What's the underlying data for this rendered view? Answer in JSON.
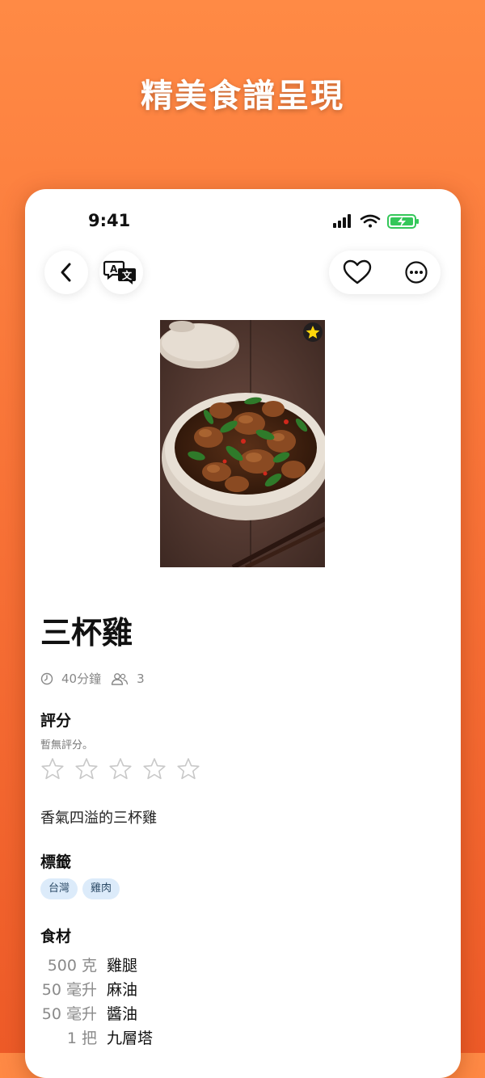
{
  "hero": {
    "title": "精美食譜呈現"
  },
  "status_bar": {
    "time": "9:41"
  },
  "toolbar": {
    "back": "back",
    "translate": "translate",
    "favorite": "favorite",
    "more": "more"
  },
  "recipe": {
    "title": "三杯雞",
    "time": "40分鐘",
    "servings": "3",
    "rating_label": "評分",
    "rating_note": "暫無評分。",
    "rating_value": 0,
    "rating_max": 5,
    "description": "香氣四溢的三杯雞",
    "tags_label": "標籤",
    "tags": [
      "台灣",
      "雞肉"
    ],
    "ingredients_label": "食材",
    "ingredients": [
      {
        "qty": "500 克",
        "name": "雞腿"
      },
      {
        "qty": "50 毫升",
        "name": "麻油"
      },
      {
        "qty": "50 毫升",
        "name": "醬油"
      },
      {
        "qty": "1 把",
        "name": "九層塔"
      }
    ]
  },
  "colors": {
    "background_top": "#FF8A45",
    "background_bottom": "#EE5B28",
    "tag_bg": "#DCEBFA",
    "battery": "#34C759",
    "featured_star": "#FFD60A"
  },
  "icons": {
    "back": "chevron-left-icon",
    "translate": "translate-icon",
    "favorite": "heart-icon",
    "more": "ellipsis-circle-icon",
    "featured": "star-badge-icon",
    "time": "clock-icon",
    "servings": "people-icon",
    "rating": "star-outline-icon"
  }
}
